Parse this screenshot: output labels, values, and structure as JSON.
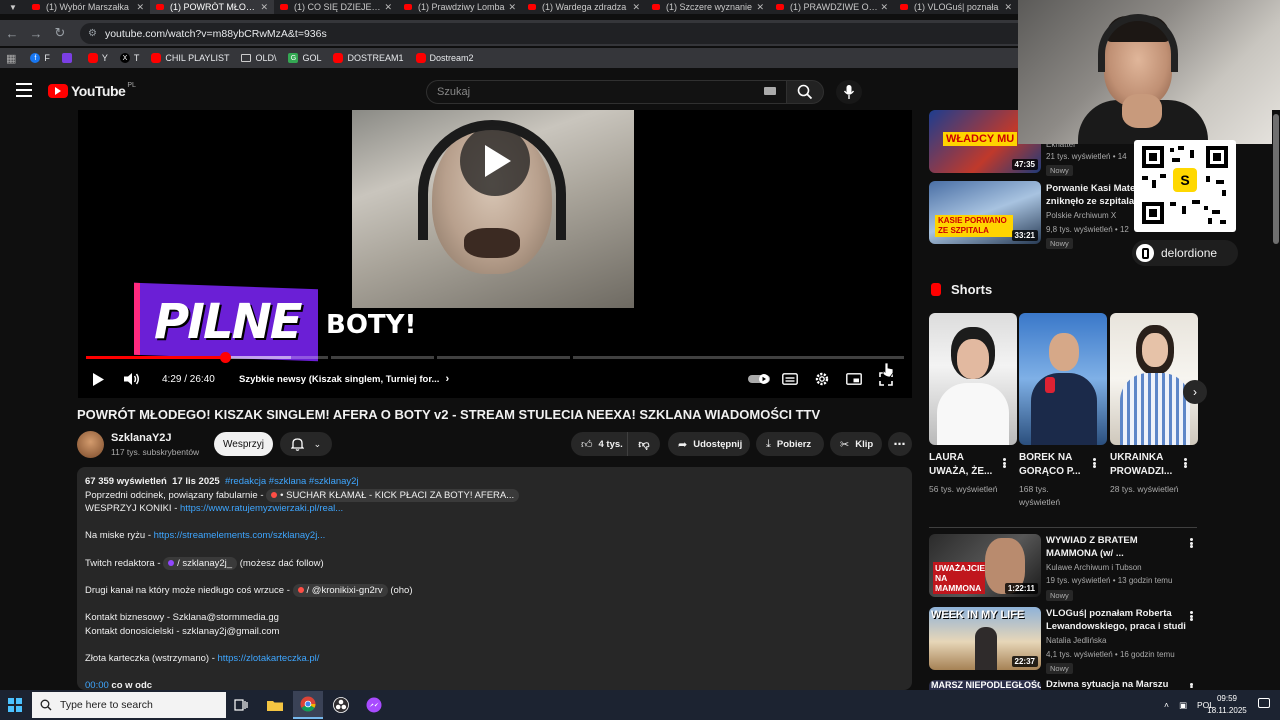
{
  "browser": {
    "tabs": [
      {
        "label": "(1) Wybór Marszałka",
        "active": false
      },
      {
        "label": "(1) POWRÓT MŁODEGO",
        "active": true
      },
      {
        "label": "(1) CO SIĘ DZIEJE, GD",
        "active": false
      },
      {
        "label": "(1) Prawdziwy Lomba",
        "active": false
      },
      {
        "label": "(1) Wardega zdradza",
        "active": false
      },
      {
        "label": "(1) Szczere wyznanie",
        "active": false
      },
      {
        "label": "(1) PRAWDZIWE OBL",
        "active": false
      },
      {
        "label": "(1) VLOGuś| poznała",
        "active": false
      }
    ],
    "url": "youtube.com/watch?v=m88ybCRwMzA&t=936s",
    "bookmarks": [
      {
        "label": "F",
        "icon": "facebook-icon",
        "color": "#1877f2"
      },
      {
        "label": "Y",
        "icon": "youtube-icon",
        "color": "#ff0000"
      },
      {
        "label": "T",
        "icon": "x-icon",
        "color": "#000000"
      },
      {
        "label": "CHIL PLAYLIST",
        "icon": "youtube-icon",
        "color": "#ff0000"
      },
      {
        "label": "OLD\\",
        "icon": "folder-icon",
        "color": "#9aa0a6"
      },
      {
        "label": "GOL",
        "icon": "gol-icon",
        "color": "#34a853"
      },
      {
        "label": "DOSTREAM1",
        "icon": "youtube-icon",
        "color": "#ff0000"
      },
      {
        "label": "Dostream2",
        "icon": "youtube-icon",
        "color": "#ff0000"
      }
    ]
  },
  "youtube": {
    "logo_text": "YouTube",
    "logo_region": "PL",
    "search_placeholder": "Szukaj"
  },
  "player": {
    "overlay_banner": "PILNE",
    "overlay_headline": "BOTY!",
    "time": "4:29 / 26:40",
    "chapter": "Szybkie newsy (Kiszak singlem, Turniej for...",
    "progress_played_fraction": 0.17,
    "progress_loaded_fraction": 0.25
  },
  "video": {
    "title": "POWRÓT MŁODEGO! KISZAK SINGLEM! AFERA O BOTY v2 - STREAM STULECIA NEEXA! SZKLANA WIADOMOŚCI TTV",
    "channel": "SzklanaY2J",
    "subscribers": "117 tys. subskrybentów",
    "support_label": "Wesprzyj",
    "likes": "4 tys.",
    "share_label": "Udostępnij",
    "download_label": "Pobierz",
    "clip_label": "Klip"
  },
  "description": {
    "views": "67 359 wyświetleń",
    "date": "17 lis 2025",
    "tags": "#redakcja #szklana #szklanay2j",
    "l1_prefix": "Poprzedni odcinek, powiązany fabularnie -",
    "l1_chip": "• SUCHAR KŁAMAŁ - KICK PŁACI ZA BOTY! AFERA...",
    "l2_prefix": "WESPRZYJ KONIKI -",
    "l2_link": "https://www.ratujemyzwierzaki.pl/real...",
    "l3_prefix": "Na miske ryżu -",
    "l3_link": "https://streamelements.com/szklanay2j...",
    "l4_prefix": "Twitch redaktora -",
    "l4_chip": "/ szklanay2j_",
    "l4_suffix": "(możesz dać follow)",
    "l5_prefix": "Drugi kanał na który może niedługo coś wrzuce -",
    "l5_chip": "/ @kronikixi-gn2rv",
    "l5_suffix": "(oho)",
    "l6": "Kontakt biznesowy - Szklana@stormmedia.gg",
    "l7": "Kontakt donosicielski - szklanay2j@gmail.com",
    "l8_prefix": "Złota karteczka (wstrzymano) -",
    "l8_link": "https://zlotakarteczka.pl/",
    "l9_time": "00:00",
    "l9_text": "co w odc"
  },
  "sidebar": {
    "top": [
      {
        "thumb_text": "WŁADCY MU",
        "duration": "47:35",
        "channel": "Ekhatter",
        "meta": "21 tys. wyświetleń • 14",
        "badge": "Nowy"
      },
      {
        "thumb_text": "KASIE PORWANO ZE SZPITALA",
        "duration": "33:21",
        "title1": "Porwanie Kasi Mate",
        "title2": "zniknęło ze szpitala",
        "channel": "Polskie Archiwum X",
        "meta": "9,8 tys. wyświetleń • 12",
        "badge": "Nowy"
      }
    ],
    "stream_handle": "delordione",
    "shorts_heading": "Shorts",
    "shorts": [
      {
        "title": "LAURA UWAŻA, ŻE...",
        "views": "56 tys. wyświetleń"
      },
      {
        "title": "BOREK NA GORĄCO P...",
        "views": "168 tys. wyświetleń"
      },
      {
        "title": "UKRAINKA PROWADZI...",
        "views": "28 tys. wyświetleń"
      }
    ],
    "bottom": [
      {
        "thumb_text": "UWAŻAJCIE NA MAMMONA",
        "duration": "1:22:11",
        "title1": "WYWIAD Z BRATEM",
        "title2": "MAMMONA (w/ ...",
        "channel": "Kulawe Archiwum i Tubson",
        "meta": "19 tys. wyświetleń • 13 godzin temu",
        "badge": "Nowy"
      },
      {
        "thumb_text": "WEEK IN MY LIFE",
        "duration": "22:37",
        "title1": "VLOGuś| poznałam Roberta",
        "title2": "Lewandowskiego, praca i studi...",
        "channel": "Natalia Jedlińska",
        "meta": "4,1 tys. wyświetleń • 16 godzin temu",
        "badge": "Nowy"
      },
      {
        "thumb_text": "MARSZ NIEPODLEGŁOŚCI 2025",
        "title1": "Dziwna sytuacja na Marszu"
      }
    ]
  },
  "taskbar": {
    "search_placeholder": "Type here to search",
    "language": "POL",
    "time": "09:59",
    "date": "18.11.2025"
  }
}
